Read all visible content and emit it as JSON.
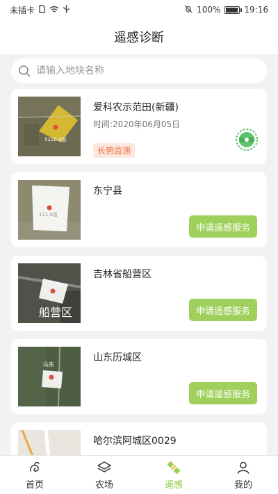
{
  "status_bar": {
    "carrier": "未插卡",
    "battery": "100%",
    "battery_level": 1.0,
    "time": "19:16",
    "icons": [
      "sim-card-icon",
      "wifi-icon",
      "usb-icon",
      "mute-icon",
      "battery-icon"
    ]
  },
  "header": {
    "title": "遥感诊断"
  },
  "search": {
    "placeholder": "请输入地块名称",
    "value": ""
  },
  "fields": [
    {
      "name": "爱科农示范田(新疆)",
      "time": "时间:2020年06月05日",
      "tag": "长势监测",
      "badge_icon": "monitoring-stamp-icon",
      "map_label": "5220.4亩",
      "colors": {
        "map": "#6d6a52",
        "overlay": "#e8c62d"
      }
    },
    {
      "name": "东宁县",
      "button": "申请遥感服务",
      "map_label": "111.6亩",
      "colors": {
        "map": "#8d8a70",
        "overlay": "#ffffff"
      }
    },
    {
      "name": "吉林省船营区",
      "button": "申请遥感服务",
      "map_label": "船营区",
      "colors": {
        "map": "#4f5248",
        "overlay": "#ffffff"
      }
    },
    {
      "name": "山东历城区",
      "button": "申请遥感服务",
      "map_label": "山东",
      "colors": {
        "map": "#4d5e43",
        "overlay": "#ffffff"
      }
    },
    {
      "name": "哈尔滨阿城区0029",
      "colors": {
        "map": "#e9e6df",
        "overlay": "#f0a640"
      }
    }
  ],
  "tabs": [
    {
      "label": "首页",
      "icon": "home-icon",
      "active": false
    },
    {
      "label": "农场",
      "icon": "farm-layers-icon",
      "active": false
    },
    {
      "label": "遥感",
      "icon": "satellite-icon",
      "active": true
    },
    {
      "label": "我的",
      "icon": "user-icon",
      "active": false
    }
  ],
  "theme": {
    "accent": "#8cc63e",
    "button": "#9fd05b",
    "tag_text": "#e96a3d",
    "tag_bg": "#fde8de"
  }
}
